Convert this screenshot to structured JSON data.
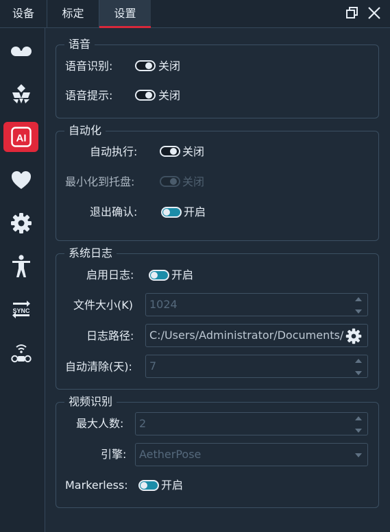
{
  "tabs": [
    {
      "label": "设备"
    },
    {
      "label": "标定"
    },
    {
      "label": "设置",
      "active": true
    }
  ],
  "window_controls": {
    "restore_icon": "restore-window-icon",
    "close_icon": "close-icon"
  },
  "sidebar": {
    "items": [
      {
        "icon": "device-icon"
      },
      {
        "icon": "calibration-icon"
      },
      {
        "icon": "ai-icon",
        "label": "AI",
        "active": true
      },
      {
        "icon": "heart-icon"
      },
      {
        "icon": "gear-icon"
      },
      {
        "icon": "person-icon"
      },
      {
        "icon": "sync-icon",
        "label": "SYNC"
      },
      {
        "icon": "wireless-tracker-icon"
      }
    ]
  },
  "voice": {
    "title": "语音",
    "recognition": {
      "label": "语音识别:",
      "state": "关闭",
      "on": false
    },
    "prompt": {
      "label": "语音提示:",
      "state": "关闭",
      "on": false
    }
  },
  "automation": {
    "title": "自动化",
    "auto_run": {
      "label": "自动执行:",
      "state": "关闭",
      "on": false
    },
    "minimize_tray": {
      "label": "最小化到托盘:",
      "state": "关闭",
      "on": false,
      "disabled": true
    },
    "exit_confirm": {
      "label": "退出确认:",
      "state": "开启",
      "on": true
    }
  },
  "syslog": {
    "title": "系统日志",
    "enable": {
      "label": "启用日志:",
      "state": "开启",
      "on": true
    },
    "file_size": {
      "label": "文件大小(K)",
      "value": "1024"
    },
    "log_path": {
      "label": "日志路径:",
      "value": "C:/Users/Administrator/Documents/"
    },
    "auto_clean": {
      "label": "自动清除(天):",
      "value": "7"
    }
  },
  "video": {
    "title": "视频识别",
    "max_people": {
      "label": "最大人数:",
      "value": "2"
    },
    "engine": {
      "label": "引擎:",
      "value": "AetherPose"
    },
    "markerless": {
      "label": "Markerless:",
      "state": "开启",
      "on": true
    }
  },
  "colors": {
    "accent": "#e0283a",
    "toggle_on": "#1b8ca8",
    "background": "#1f2b38"
  }
}
